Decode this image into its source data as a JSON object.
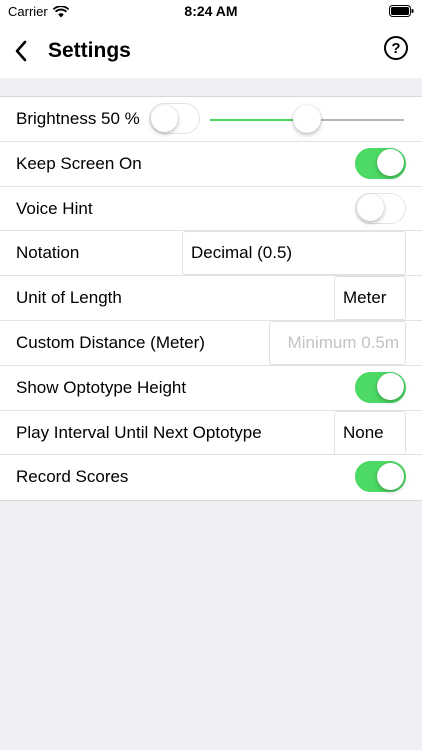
{
  "status_bar": {
    "carrier": "Carrier",
    "time": "8:24 AM"
  },
  "nav": {
    "title": "Settings",
    "help_label": "?"
  },
  "settings": {
    "brightness": {
      "label": "Brightness 50 %",
      "toggle_on": false,
      "slider_value": 0.5
    },
    "keep_screen_on": {
      "label": "Keep Screen On",
      "toggle_on": true
    },
    "voice_hint": {
      "label": "Voice Hint",
      "toggle_on": false
    },
    "notation": {
      "label": "Notation",
      "value": "Decimal (0.5)"
    },
    "unit_of_length": {
      "label": "Unit of Length",
      "value": "Meter"
    },
    "custom_distance": {
      "label": "Custom Distance (Meter)",
      "placeholder": "Minimum 0.5m"
    },
    "show_optotype_height": {
      "label": "Show Optotype Height",
      "toggle_on": true
    },
    "play_interval": {
      "label": "Play Interval Until Next Optotype",
      "value": "None"
    },
    "record_scores": {
      "label": "Record Scores",
      "toggle_on": true
    }
  },
  "colors": {
    "accent_green": "#4cd964",
    "background": "#efeff4",
    "placeholder": "#c3c3c7"
  },
  "icons": {
    "back": "chevron-left-icon",
    "help": "question-circle-icon",
    "wifi": "wifi-icon",
    "battery": "battery-icon"
  }
}
